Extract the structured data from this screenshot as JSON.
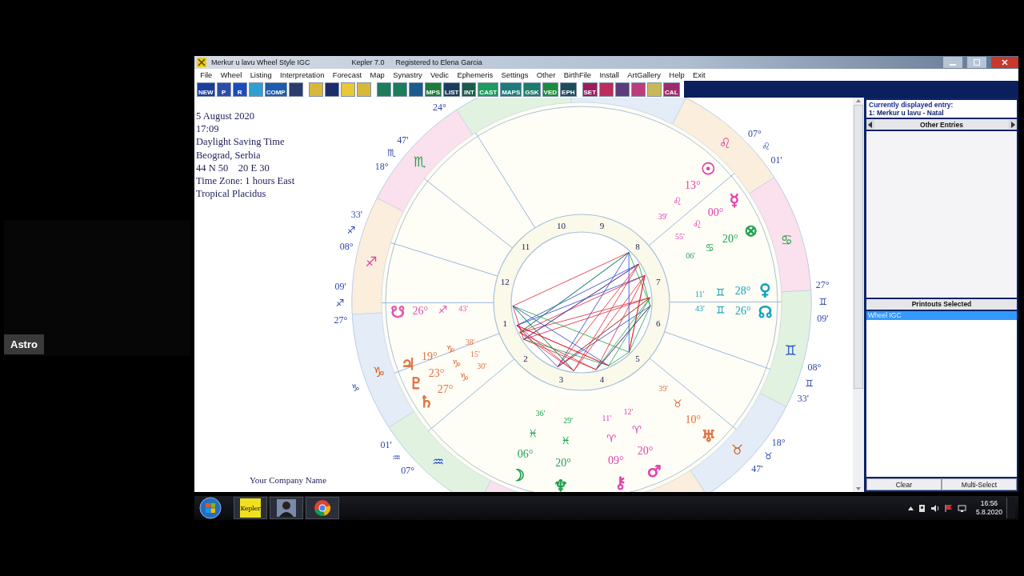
{
  "stream_tile": {
    "label": "Astro"
  },
  "window": {
    "title": "Merkur u lavu Wheel Style IGC",
    "version": "Kepler 7.0",
    "registration": "Registered to Elena Garcia"
  },
  "menu": [
    "File",
    "Wheel",
    "Listing",
    "Interpretation",
    "Forecast",
    "Map",
    "Synastry",
    "Vedic",
    "Ephemeris",
    "Settings",
    "Other",
    "BirthFile",
    "Install",
    "ArtGallery",
    "Help",
    "Exit"
  ],
  "toolbar": [
    [
      {
        "label": "NEW",
        "color": "#1c3c9c"
      },
      {
        "label": "P",
        "color": "#2c4cac"
      },
      {
        "label": "R",
        "color": "#1c4cbc"
      },
      {
        "color": "#30a0d0"
      },
      {
        "label": "COMP",
        "color": "#1c5cac"
      },
      {
        "color": "#2c3c6c"
      }
    ],
    [
      {
        "color": "#d8b838"
      },
      {
        "color": "#1c2c6c"
      },
      {
        "color": "#e8c838"
      },
      {
        "color": "#d8b838"
      }
    ],
    [
      {
        "color": "#1c7c5c"
      },
      {
        "color": "#1c7c5c"
      },
      {
        "color": "#1c5c8c"
      },
      {
        "label": "MPS",
        "color": "#1c7c3c"
      },
      {
        "label": "LIST",
        "color": "#1c3c5c"
      },
      {
        "label": "INT",
        "color": "#1c5c4c"
      },
      {
        "label": "CAST",
        "color": "#1c9c5c"
      },
      {
        "label": "MAPS",
        "color": "#1c7c7c"
      },
      {
        "label": "GSK",
        "color": "#1c7c6c"
      },
      {
        "label": "VED",
        "color": "#1c8c3c"
      },
      {
        "label": "EPH",
        "color": "#1c4c5c"
      }
    ],
    [
      {
        "label": "SET",
        "color": "#9c1c5c"
      },
      {
        "color": "#bc2c5c"
      },
      {
        "color": "#5c3c7c"
      },
      {
        "color": "#bc3c7c"
      },
      {
        "color": "#c8b858"
      },
      {
        "label": "CAL",
        "color": "#9c2c6c"
      }
    ]
  ],
  "chart_info": [
    "5 August 2020",
    "17:09",
    "Daylight Saving Time",
    "Beograd, Serbia",
    "44 N 50    20 E 30",
    "Time Zone: 1 hours East",
    "Tropical Placidus"
  ],
  "company": "Your Company Name",
  "zodiac": [
    {
      "glyph": "♌",
      "color": "#e040a0"
    },
    {
      "glyph": "♏",
      "color": "#20a040"
    },
    {
      "glyph": "♋",
      "color": "#20a040"
    },
    {
      "glyph": "♐",
      "color": "#e040a0"
    },
    {
      "glyph": "♊",
      "color": "#2050d0"
    },
    {
      "glyph": "♑",
      "color": "#d06020"
    },
    {
      "glyph": "♉",
      "color": "#d06020"
    },
    {
      "glyph": "♒",
      "color": "#2050d0"
    }
  ],
  "houses": [
    "1",
    "2",
    "3",
    "4",
    "5",
    "6",
    "7",
    "8",
    "9",
    "10",
    "11",
    "12"
  ],
  "outer_cusps": [
    {
      "degree": "24°"
    },
    {
      "degree": "18°",
      "sign": "♏",
      "minutes": "47'"
    },
    {
      "degree": "07°",
      "sign": "♌",
      "minutes": "01'"
    },
    {
      "degree": "08°",
      "sign": "♐",
      "minutes": "33'"
    },
    {
      "degree": "27°",
      "sign": "♐",
      "minutes": "09'"
    },
    {
      "degree": "27°",
      "sign": "♊",
      "minutes": "09'"
    },
    {
      "degree": "08°",
      "sign": "♊",
      "minutes": "33'"
    },
    {
      "sign": "♑"
    },
    {
      "degree": "07°",
      "sign": "♒",
      "minutes": "01'"
    },
    {
      "degree": "18°",
      "sign": "♉",
      "minutes": "47'"
    }
  ],
  "planets": [
    {
      "glyph": "☉",
      "degree": "13°",
      "sign": "♌",
      "minutes": "39'",
      "color": "#e040b0"
    },
    {
      "glyph": "☿",
      "degree": "00°",
      "sign": "♌",
      "minutes": "55'",
      "color": "#e040b0"
    },
    {
      "glyph": "⊗",
      "degree": "20°",
      "sign": "♋",
      "minutes": "06'",
      "color": "#20a050"
    },
    {
      "glyph": "♀",
      "degree": "28°",
      "sign": "♊",
      "minutes": "11'",
      "color": "#10a0c0"
    },
    {
      "glyph": "☋",
      "degree": "26°",
      "sign": "♐",
      "minutes": "43'",
      "color": "#e050b0"
    },
    {
      "glyph": "☊",
      "degree": "26°",
      "sign": "♊",
      "minutes": "43'",
      "color": "#10a0c0"
    },
    {
      "glyph": "♃",
      "degree": "19°",
      "sign": "♑",
      "minutes": "38'",
      "color": "#e07040"
    },
    {
      "glyph": "♇",
      "degree": "23°",
      "sign": "♑",
      "minutes": "15'",
      "color": "#e07040"
    },
    {
      "glyph": "♄",
      "degree": "27°",
      "sign": "♑",
      "minutes": "30'",
      "color": "#e07040"
    },
    {
      "glyph": "♅",
      "degree": "10°",
      "sign": "♉",
      "minutes": "39'",
      "color": "#e07040"
    },
    {
      "glyph": "☽",
      "degree": "06°",
      "sign": "♓",
      "minutes": "36'",
      "color": "#20a050"
    },
    {
      "glyph": "♆",
      "degree": "20°",
      "sign": "♓",
      "minutes": "29'",
      "color": "#20a050"
    },
    {
      "glyph": "⚷",
      "degree": "09°",
      "sign": "♈",
      "minutes": "11'",
      "color": "#e040b0"
    },
    {
      "glyph": "♂",
      "degree": "20°",
      "sign": "♈",
      "minutes": "12'",
      "color": "#e040b0"
    }
  ],
  "side_panel": {
    "entry_caption": "Currently displayed entry:",
    "entry": "1: Merkur u lavu - Natal",
    "other_entries": "Other Entries",
    "printouts_header": "Printouts Selected",
    "printouts": [
      {
        "label": "Wheel IGC",
        "selected": true
      }
    ],
    "buttons": [
      "Clear",
      "Multi-Select"
    ]
  },
  "taskbar": {
    "apps": [
      {
        "kind": "kepler",
        "label": "Kepler"
      },
      {
        "kind": "person"
      },
      {
        "kind": "browser"
      }
    ],
    "time": "16:56",
    "date": "5.8.2020"
  }
}
